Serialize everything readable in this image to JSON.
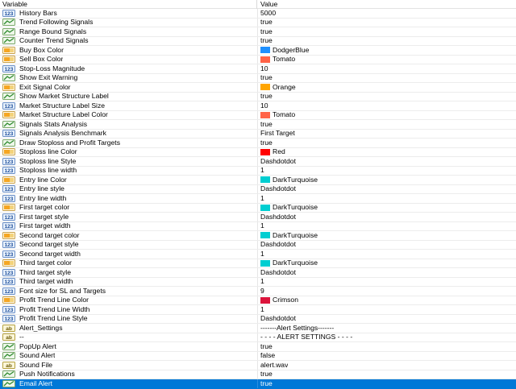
{
  "header": {
    "variable": "Variable",
    "value": "Value"
  },
  "rows": [
    {
      "icon": "int-icon",
      "name": "History Bars",
      "value": "5000",
      "color": null
    },
    {
      "icon": "bool-icon",
      "name": "Trend Following Signals",
      "value": "true",
      "color": null
    },
    {
      "icon": "bool-icon",
      "name": "Range Bound Signals",
      "value": "true",
      "color": null
    },
    {
      "icon": "bool-icon",
      "name": "Counter Trend Signals",
      "value": "true",
      "color": null
    },
    {
      "icon": "color-icon",
      "name": "Buy Box Color",
      "value": "DodgerBlue",
      "color": "#1e90ff"
    },
    {
      "icon": "color-icon",
      "name": "Sell Box Color",
      "value": "Tomato",
      "color": "#ff6347"
    },
    {
      "icon": "double-icon",
      "name": "Stop-Loss Magnitude",
      "value": "10",
      "color": null
    },
    {
      "icon": "bool-icon",
      "name": "Show Exit Warning",
      "value": "true",
      "color": null
    },
    {
      "icon": "color-icon",
      "name": "Exit Signal Color",
      "value": "Orange",
      "color": "#ffa500"
    },
    {
      "icon": "bool-icon",
      "name": "Show Market Structure Label",
      "value": "true",
      "color": null
    },
    {
      "icon": "int-icon",
      "name": "Market Structure Label Size",
      "value": "10",
      "color": null
    },
    {
      "icon": "color-icon",
      "name": "Market Structure Label Color",
      "value": "Tomato",
      "color": "#ff6347"
    },
    {
      "icon": "bool-icon",
      "name": "Signals Stats Analysis",
      "value": "true",
      "color": null
    },
    {
      "icon": "int-icon",
      "name": "Signals Analysis Benchmark",
      "value": "First Target",
      "color": null
    },
    {
      "icon": "bool-icon",
      "name": "Draw Stoploss and Profit Targets",
      "value": "true",
      "color": null
    },
    {
      "icon": "color-icon",
      "name": "Stoploss line Color",
      "value": "Red",
      "color": "#ff0000"
    },
    {
      "icon": "int-icon",
      "name": "Stoploss line Style",
      "value": "Dashdotdot",
      "color": null
    },
    {
      "icon": "int-icon",
      "name": "Stoploss line width",
      "value": "1",
      "color": null
    },
    {
      "icon": "color-icon",
      "name": "Entry line Color",
      "value": "DarkTurquoise",
      "color": "#00ced1"
    },
    {
      "icon": "int-icon",
      "name": "Entry line style",
      "value": "Dashdotdot",
      "color": null
    },
    {
      "icon": "int-icon",
      "name": "Entry line width",
      "value": "1",
      "color": null
    },
    {
      "icon": "color-icon",
      "name": "First target color",
      "value": "DarkTurquoise",
      "color": "#00ced1"
    },
    {
      "icon": "int-icon",
      "name": "First target style",
      "value": "Dashdotdot",
      "color": null
    },
    {
      "icon": "int-icon",
      "name": "First target width",
      "value": "1",
      "color": null
    },
    {
      "icon": "color-icon",
      "name": "Second target color",
      "value": "DarkTurquoise",
      "color": "#00ced1"
    },
    {
      "icon": "int-icon",
      "name": "Second target style",
      "value": "Dashdotdot",
      "color": null
    },
    {
      "icon": "int-icon",
      "name": "Second target width",
      "value": "1",
      "color": null
    },
    {
      "icon": "color-icon",
      "name": "Third target color",
      "value": "DarkTurquoise",
      "color": "#00ced1"
    },
    {
      "icon": "int-icon",
      "name": "Third target style",
      "value": "Dashdotdot",
      "color": null
    },
    {
      "icon": "int-icon",
      "name": "Third target width",
      "value": "1",
      "color": null
    },
    {
      "icon": "int-icon",
      "name": "Font size for SL and Targets",
      "value": "9",
      "color": null
    },
    {
      "icon": "color-icon",
      "name": "Profit Trend Line Color",
      "value": "Crimson",
      "color": "#dc143c"
    },
    {
      "icon": "int-icon",
      "name": "Profit Trend Line Width",
      "value": "1",
      "color": null
    },
    {
      "icon": "int-icon",
      "name": "Profit Trend Line Style",
      "value": "Dashdotdot",
      "color": null
    },
    {
      "icon": "string-icon",
      "name": "Alert_Settings",
      "value": "-------Alert Settings-------",
      "color": null
    },
    {
      "icon": "string-icon",
      "name": "--",
      "value": "- - - - ALERT SETTINGS - - - -",
      "color": null
    },
    {
      "icon": "bool-icon",
      "name": "PopUp Alert",
      "value": "true",
      "color": null
    },
    {
      "icon": "bool-icon",
      "name": "Sound Alert",
      "value": "false",
      "color": null
    },
    {
      "icon": "string-icon",
      "name": "Sound File",
      "value": "alert.wav",
      "color": null
    },
    {
      "icon": "bool-icon",
      "name": "Push Notifications",
      "value": "true",
      "color": null
    },
    {
      "icon": "bool-icon",
      "name": "Email Alert",
      "value": "true",
      "color": null,
      "selected": true
    }
  ]
}
